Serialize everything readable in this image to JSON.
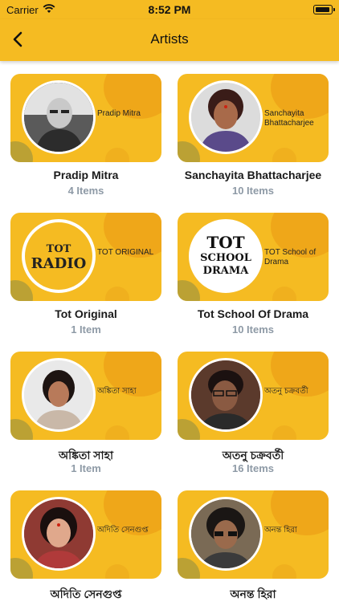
{
  "status_bar": {
    "carrier": "Carrier",
    "time": "8:52 PM"
  },
  "nav": {
    "title": "Artists"
  },
  "colors": {
    "brand": "#F5BB22",
    "count_text": "#8E9AA6"
  },
  "artists": [
    {
      "name": "Pradip Mitra",
      "caption": "Pradip Mitra",
      "count": "4 Items"
    },
    {
      "name": "Sanchayita Bhattacharjee",
      "caption": "Sanchayita Bhattacharjee",
      "count": "10 Items"
    },
    {
      "name": "Tot Original",
      "caption": "TOT ORIGINAL",
      "logo_line1": "TOT",
      "logo_line2": "RADIO",
      "count": "1 Item"
    },
    {
      "name": "Tot School Of Drama",
      "caption": "TOT School of Drama",
      "logo_line1": "TOT",
      "logo_line2": "SCHOOL",
      "logo_line3": "DRAMA",
      "count": "10 Items"
    },
    {
      "name": "অঙ্কিতা সাহা",
      "caption": "অঙ্কিতা সাহা",
      "count": "1 Item"
    },
    {
      "name": "অতনু চক্রবর্তী",
      "caption": "অতনু চক্রবর্তী",
      "count": "16 Items"
    },
    {
      "name": "অদিতি সেনগুপ্ত",
      "caption": "অদিতি সেনগুপ্ত",
      "count": ""
    },
    {
      "name": "অনন্ত হিরা",
      "caption": "অনন্ত হিরা",
      "count": ""
    }
  ]
}
